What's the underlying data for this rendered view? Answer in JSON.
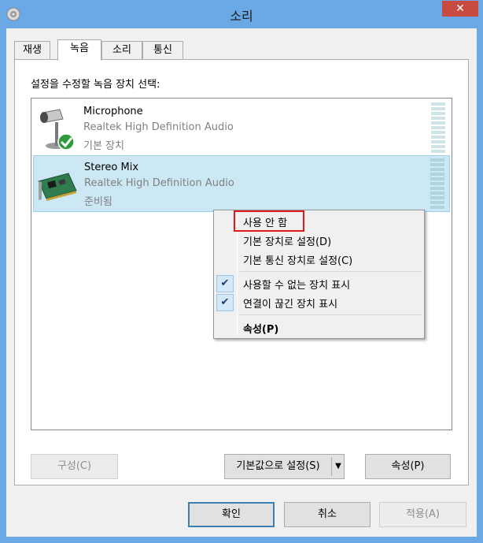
{
  "window": {
    "title": "소리",
    "close_glyph": "✕"
  },
  "tabs": [
    {
      "label": "재생"
    },
    {
      "label": "녹음"
    },
    {
      "label": "소리"
    },
    {
      "label": "통신"
    }
  ],
  "active_tab": "녹음",
  "panel": {
    "caption": "설정을 수정할 녹음 장치 선택:"
  },
  "devices": [
    {
      "name": "Microphone",
      "driver": "Realtek High Definition Audio",
      "status": "기본 장치",
      "icon": "microphone-icon",
      "default_badge": "check-icon",
      "selected": false
    },
    {
      "name": "Stereo Mix",
      "driver": "Realtek High Definition Audio",
      "status": "준비됨",
      "icon": "sound-card-icon",
      "selected": true
    }
  ],
  "context_menu": {
    "items": [
      {
        "label": "사용 안 함",
        "checked": false
      },
      {
        "label": "기본 장치로 설정(D)",
        "checked": false
      },
      {
        "label": "기본 통신 장치로 설정(C)",
        "checked": false
      },
      {
        "label": "사용할 수 없는 장치 표시",
        "checked": true
      },
      {
        "label": "연결이 끊긴 장치 표시",
        "checked": true
      },
      {
        "label": "속성(P)",
        "checked": false,
        "bold": true
      }
    ],
    "check_glyph": "✔"
  },
  "buttons": {
    "configure": "구성(C)",
    "set_default": "기본값으로 설정(S)",
    "dropdown_glyph": "▼",
    "properties": "속성(P)",
    "ok": "확인",
    "cancel": "취소",
    "apply": "적용(A)"
  },
  "colors": {
    "titlebar": "#6aa8e6",
    "close_button": "#c74b41",
    "selection": "#cce8f4",
    "highlight": "#e01a1a"
  }
}
